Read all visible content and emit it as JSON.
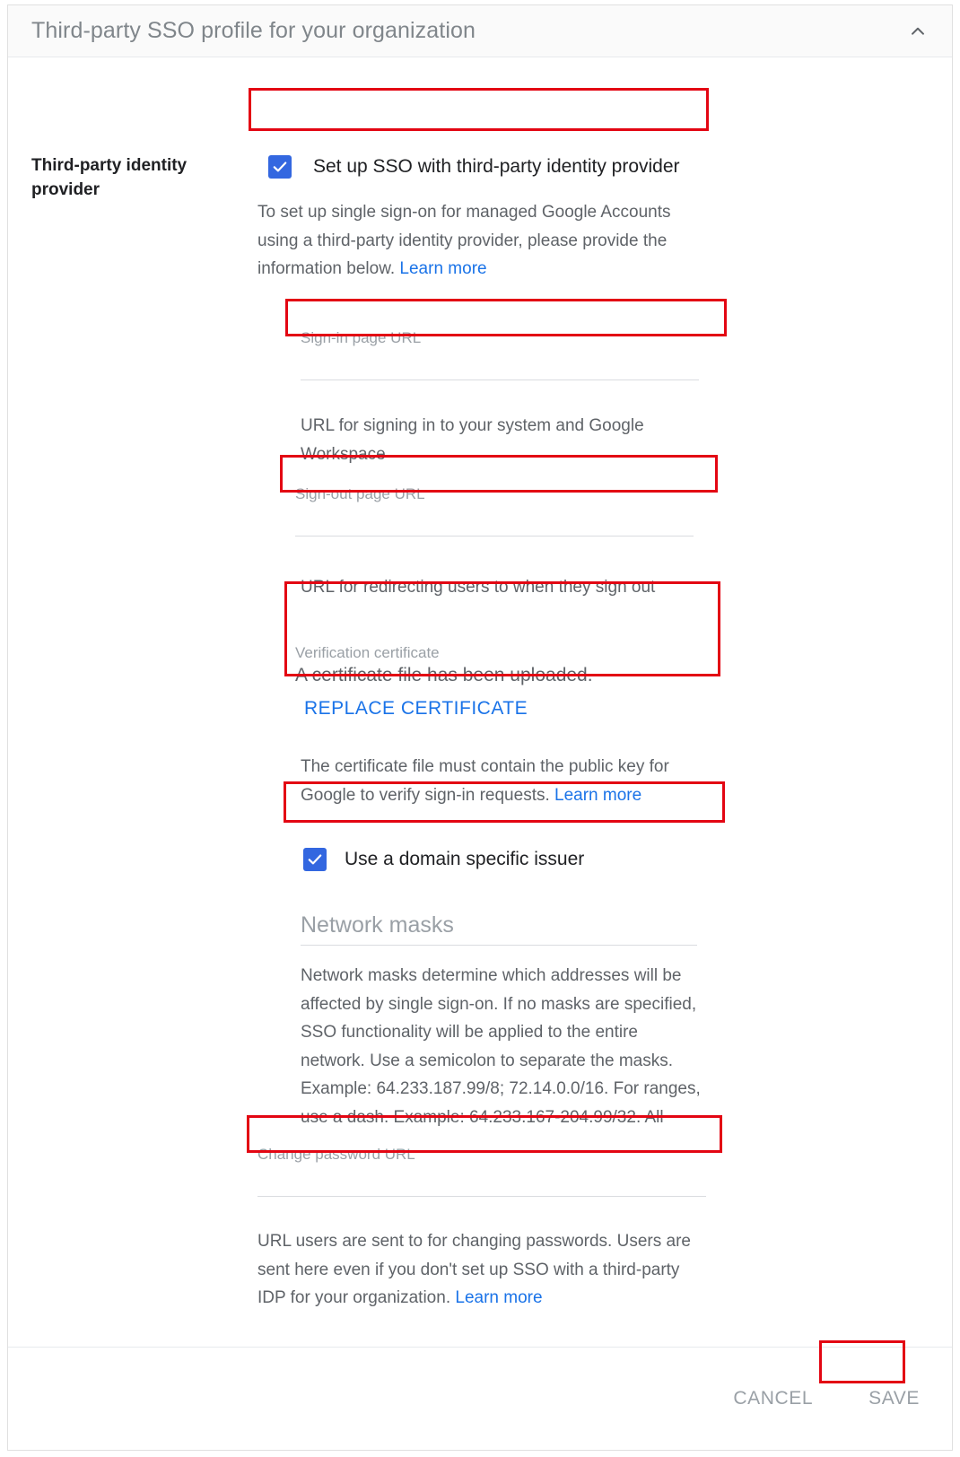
{
  "header": {
    "title": "Third-party SSO profile for your organization",
    "collapse_icon": "chevron-up-icon"
  },
  "section": {
    "label": "Third-party identity provider"
  },
  "sso_checkbox": {
    "label": "Set up SSO with third-party identity provider",
    "checked": true
  },
  "intro": {
    "text": "To set up single sign-on for managed Google Accounts using a third-party identity provider, please provide the information below. ",
    "link": "Learn more"
  },
  "signin_field": {
    "label": "Sign-in page URL",
    "value": "",
    "placeholder": "",
    "help": "URL for signing in to your system and Google Workspace"
  },
  "signout_field": {
    "label": "Sign-out page URL",
    "value": "",
    "placeholder": "",
    "help": "URL for redirecting users to when they sign out"
  },
  "certificate": {
    "caption": "Verification certificate",
    "status": "A certificate file has been uploaded.",
    "action": "REPLACE CERTIFICATE",
    "help_text": "The certificate file must contain the public key for Google to verify sign-in requests. ",
    "help_link": "Learn more"
  },
  "issuer_checkbox": {
    "label": "Use a domain specific issuer",
    "checked": true
  },
  "network_masks": {
    "heading": "Network masks",
    "description": "Network masks determine which addresses will be affected by single sign-on. If no masks are specified, SSO functionality will be applied to the entire network. Use a semicolon to separate the masks. Example: 64.233.187.99/8; 72.14.0.0/16. For ranges, use a dash. Example: 64.233.167-204.99/32. All"
  },
  "change_password_field": {
    "label": "Change password URL",
    "value": "",
    "placeholder": "",
    "help_text": "URL users are sent to for changing passwords. Users are sent here even if you don't set up SSO with a third-party IDP for your organization. ",
    "help_link": "Learn more"
  },
  "footer": {
    "cancel_label": "CANCEL",
    "save_label": "SAVE"
  },
  "colors": {
    "accent_blue": "#1a73e8",
    "checkbox_blue": "#3367e0",
    "annotation_red": "#e30613",
    "text_primary": "#202124",
    "text_secondary": "#5f6368",
    "text_muted": "#9aa0a6"
  }
}
